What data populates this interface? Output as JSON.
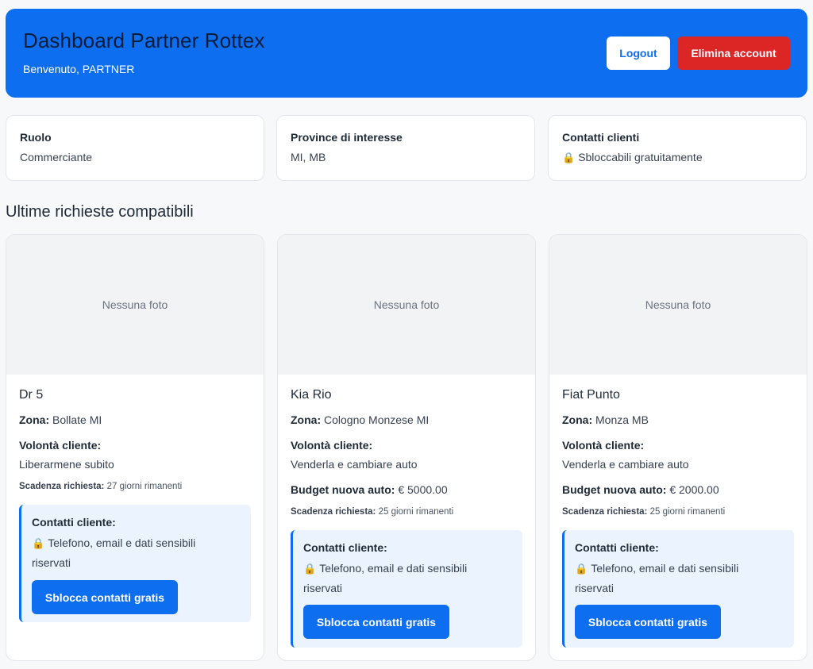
{
  "header": {
    "title": "Dashboard Partner Rottex",
    "welcome": "Benvenuto, PARTNER",
    "logout_label": "Logout",
    "delete_label": "Elimina account"
  },
  "info": [
    {
      "label": "Ruolo",
      "value": "Commerciante",
      "icon": ""
    },
    {
      "label": "Province di interesse",
      "value": "MI, MB",
      "icon": ""
    },
    {
      "label": "Contatti clienti",
      "value": "Sbloccabili gratuitamente",
      "icon": "lock-icon"
    }
  ],
  "section_title": "Ultime richieste compatibili",
  "requests": [
    {
      "photo": "Nessuna foto",
      "car": "Dr 5",
      "zona_label": "Zona:",
      "zona": "Bollate MI",
      "volonta_label": "Volontà cliente:",
      "volonta": "Liberarmene subito",
      "budget_label": "",
      "budget": "",
      "scadenza_label": "Scadenza richiesta:",
      "scadenza": "27 giorni rimanenti",
      "contact_title": "Contatti cliente:",
      "contact_text": "Telefono, email e dati sensibili riservati",
      "unlock_label": "Sblocca contatti gratis"
    },
    {
      "photo": "Nessuna foto",
      "car": "Kia Rio",
      "zona_label": "Zona:",
      "zona": "Cologno Monzese MI",
      "volonta_label": "Volontà cliente:",
      "volonta": "Venderla e cambiare auto",
      "budget_label": "Budget nuova auto:",
      "budget": "€ 5000.00",
      "scadenza_label": "Scadenza richiesta:",
      "scadenza": "25 giorni rimanenti",
      "contact_title": "Contatti cliente:",
      "contact_text": "Telefono, email e dati sensibili riservati",
      "unlock_label": "Sblocca contatti gratis"
    },
    {
      "photo": "Nessuna foto",
      "car": "Fiat Punto",
      "zona_label": "Zona:",
      "zona": "Monza MB",
      "volonta_label": "Volontà cliente:",
      "volonta": "Venderla e cambiare auto",
      "budget_label": "Budget nuova auto:",
      "budget": "€ 2000.00",
      "scadenza_label": "Scadenza richiesta:",
      "scadenza": "25 giorni rimanenti",
      "contact_title": "Contatti cliente:",
      "contact_text": "Telefono, email e dati sensibili riservati",
      "unlock_label": "Sblocca contatti gratis"
    }
  ]
}
